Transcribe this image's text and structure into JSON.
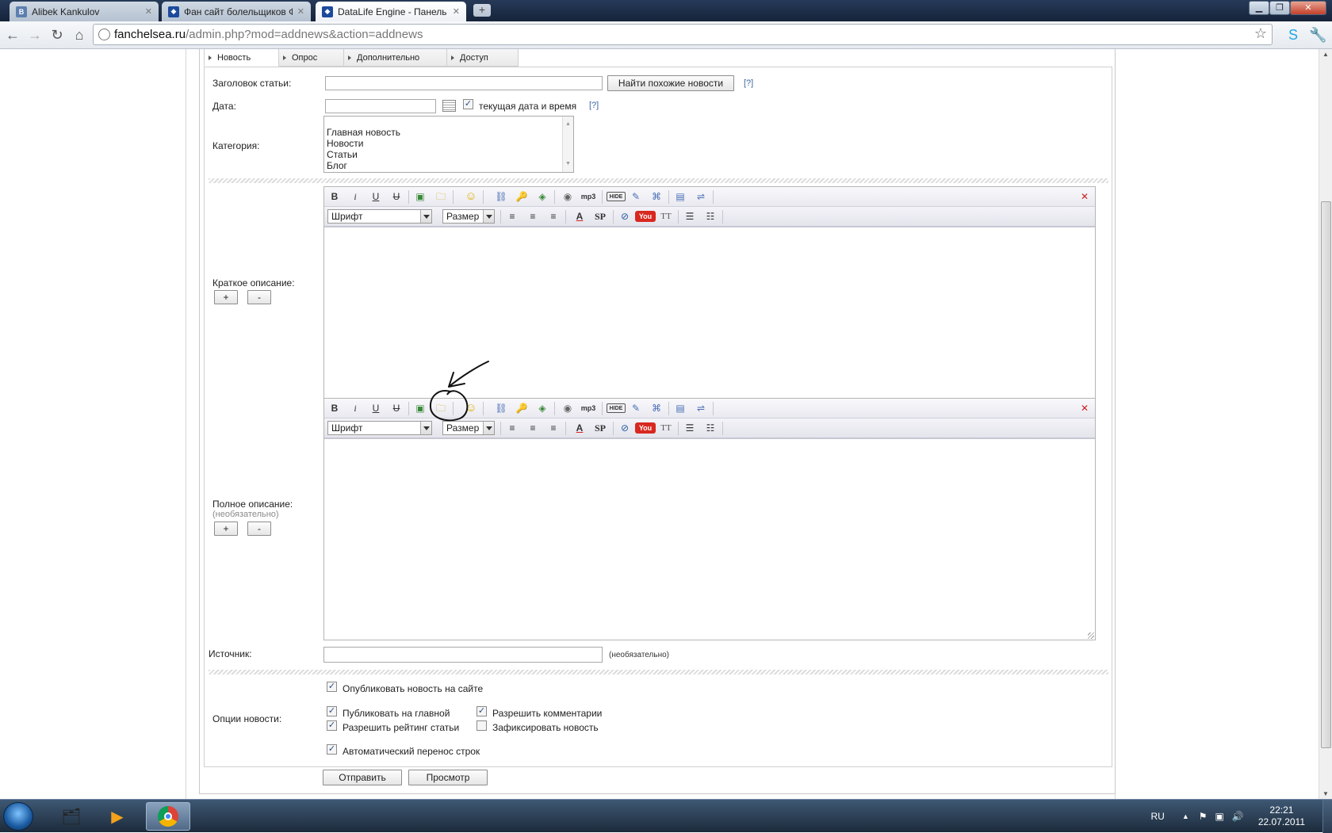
{
  "browser": {
    "tabs": [
      {
        "title": "Alibek Kankulov",
        "favicon_letter": "B",
        "active": false
      },
      {
        "title": "Фан сайт болельщиков Ф",
        "favicon_letter": "",
        "active": false
      },
      {
        "title": "DataLife Engine - Панель у",
        "favicon_letter": "",
        "active": true
      }
    ],
    "new_tab_label": "+",
    "url_host": "fanchelsea.ru",
    "url_path": "/admin.php?mod=addnews&action=addnews"
  },
  "form_tabs": [
    {
      "label": "Новость",
      "active": true
    },
    {
      "label": "Опрос",
      "active": false
    },
    {
      "label": "Дополнительно",
      "active": false
    },
    {
      "label": "Доступ",
      "active": false
    }
  ],
  "fields": {
    "title_label": "Заголовок статьи:",
    "title_value": "",
    "find_similar_button": "Найти похожие новости",
    "help": "[?]",
    "date_label": "Дата:",
    "date_value": "",
    "current_date_label": "текущая дата и время",
    "current_date_checked": true,
    "category_label": "Категория:",
    "categories": [
      "Главная новость",
      "Новости",
      "Статьи",
      "Блог"
    ],
    "short_label": "Краткое описание:",
    "full_label": "Полное описание:",
    "full_sub": "(необязательно)",
    "plus": "+",
    "minus": "-",
    "source_label": "Источник:",
    "source_value": "",
    "source_sub": "(необязательно)"
  },
  "editor": {
    "font_select": "Шрифт",
    "size_select": "Размер",
    "mp3_label": "mp3",
    "hide_label": "HIDE",
    "sp_label": "SP",
    "tt_label": "TT",
    "youtube_label": "You"
  },
  "options": {
    "label": "Опции новости:",
    "publish": {
      "label": "Опубликовать новость на сайте",
      "checked": true
    },
    "main": {
      "label": "Публиковать на главной",
      "checked": true
    },
    "comments": {
      "label": "Разрешить комментарии",
      "checked": true
    },
    "rating": {
      "label": "Разрешить рейтинг статьи",
      "checked": true
    },
    "fix": {
      "label": "Зафиксировать новость",
      "checked": false
    },
    "autowrap": {
      "label": "Автоматический перенос строк",
      "checked": true
    }
  },
  "actions": {
    "submit": "Отправить",
    "preview": "Просмотр"
  },
  "taskbar": {
    "lang": "RU",
    "time": "22:21",
    "date": "22.07.2011"
  }
}
